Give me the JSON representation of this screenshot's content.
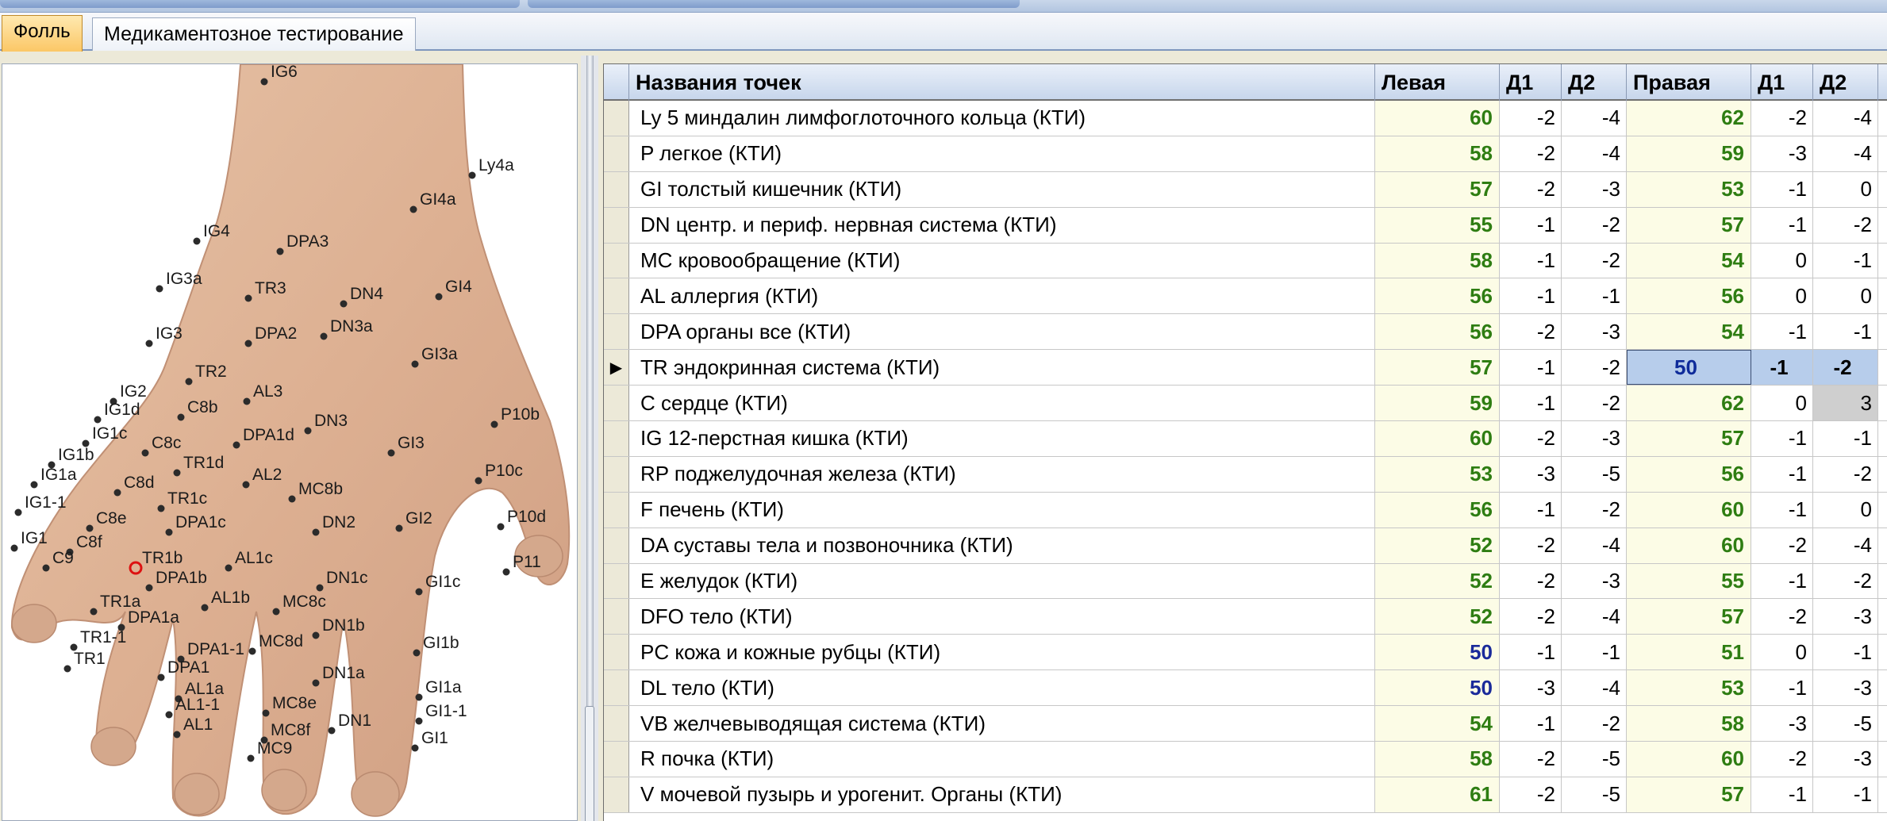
{
  "tabs": [
    {
      "label": "Фолль",
      "active": true
    },
    {
      "label": "Медикаментозное тестирование",
      "active": false
    }
  ],
  "grid": {
    "columns": [
      "Названия точек",
      "Левая",
      "Д1",
      "Д2",
      "Правая",
      "Д1",
      "Д2"
    ],
    "selected_row": 7,
    "rows": [
      {
        "name": "Ly  5 миндалин лимфоглоточного кольца (КТИ)",
        "left": "60",
        "ld1": "-2",
        "ld2": "-4",
        "right": "62",
        "rd1": "-2",
        "rd2": "-4"
      },
      {
        "name": "P  легкое (КТИ)",
        "left": "58",
        "ld1": "-2",
        "ld2": "-4",
        "right": "59",
        "rd1": "-3",
        "rd2": "-4"
      },
      {
        "name": "GI  толстый кишечник (КТИ)",
        "left": "57",
        "ld1": "-2",
        "ld2": "-3",
        "right": "53",
        "rd1": "-1",
        "rd2": "0"
      },
      {
        "name": "DN  центр. и периф. нервная система (КТИ)",
        "left": "55",
        "ld1": "-1",
        "ld2": "-2",
        "right": "57",
        "rd1": "-1",
        "rd2": "-2"
      },
      {
        "name": "MC кровообращение (КТИ)",
        "left": "58",
        "ld1": "-1",
        "ld2": "-2",
        "right": "54",
        "rd1": "0",
        "rd2": "-1"
      },
      {
        "name": "AL аллергия (КТИ)",
        "left": "56",
        "ld1": "-1",
        "ld2": "-1",
        "right": "56",
        "rd1": "0",
        "rd2": "0"
      },
      {
        "name": "DPA органы все (КТИ)",
        "left": "56",
        "ld1": "-2",
        "ld2": "-3",
        "right": "54",
        "rd1": "-1",
        "rd2": "-1"
      },
      {
        "name": "TR эндокринная система (КТИ)",
        "left": "57",
        "ld1": "-1",
        "ld2": "-2",
        "right": "50",
        "rd1": "-1",
        "rd2": "-2"
      },
      {
        "name": "C сердце (КТИ)",
        "left": "59",
        "ld1": "-1",
        "ld2": "-2",
        "right": "62",
        "rd1": "0",
        "rd2": "3"
      },
      {
        "name": "IG 12-перстная кишка (КТИ)",
        "left": "60",
        "ld1": "-2",
        "ld2": "-3",
        "right": "57",
        "rd1": "-1",
        "rd2": "-1"
      },
      {
        "name": "RP поджелудочная железа (КТИ)",
        "left": "53",
        "ld1": "-3",
        "ld2": "-5",
        "right": "56",
        "rd1": "-1",
        "rd2": "-2"
      },
      {
        "name": "F печень (КТИ)",
        "left": "56",
        "ld1": "-1",
        "ld2": "-2",
        "right": "60",
        "rd1": "-1",
        "rd2": "0"
      },
      {
        "name": "DA суставы тела и позвоночника (КТИ)",
        "left": "52",
        "ld1": "-2",
        "ld2": "-4",
        "right": "60",
        "rd1": "-2",
        "rd2": "-4"
      },
      {
        "name": "E желудок (КТИ)",
        "left": "52",
        "ld1": "-2",
        "ld2": "-3",
        "right": "55",
        "rd1": "-1",
        "rd2": "-2"
      },
      {
        "name": "DFO тело (КТИ)",
        "left": "52",
        "ld1": "-2",
        "ld2": "-4",
        "right": "57",
        "rd1": "-2",
        "rd2": "-3"
      },
      {
        "name": "PC кожа и кожные рубцы (КТИ)",
        "left": "50",
        "ld1": "-1",
        "ld2": "-1",
        "right": "51",
        "rd1": "0",
        "rd2": "-1"
      },
      {
        "name": "DL тело (КТИ)",
        "left": "50",
        "ld1": "-3",
        "ld2": "-4",
        "right": "53",
        "rd1": "-1",
        "rd2": "-3"
      },
      {
        "name": "VB желчевыводящая система (КТИ)",
        "left": "54",
        "ld1": "-1",
        "ld2": "-2",
        "right": "58",
        "rd1": "-3",
        "rd2": "-5"
      },
      {
        "name": "R почка (КТИ)",
        "left": "58",
        "ld1": "-2",
        "ld2": "-5",
        "right": "60",
        "rd1": "-2",
        "rd2": "-3"
      },
      {
        "name": "V мочевой пузырь и урогенит. Органы (КТИ)",
        "left": "61",
        "ld1": "-2",
        "ld2": "-5",
        "right": "57",
        "rd1": "-1",
        "rd2": "-1"
      }
    ]
  },
  "hand_points": [
    "IG6",
    "Ly4a",
    "GI4a",
    "IG4",
    "DPA3",
    "IG3a",
    "TR3",
    "DN4",
    "GI4",
    "IG3",
    "DPA2",
    "DN3a",
    "GI3a",
    "TR2",
    "AL3",
    "IG2",
    "IG1d",
    "C8b",
    "DN3",
    "P10b",
    "IG1c",
    "DPA1d",
    "GI3",
    "C8c",
    "IG1b",
    "TR1d",
    "IG1a",
    "C8d",
    "AL2",
    "P10c",
    "MC8b",
    "TR1c",
    "IG1-1",
    "C8e",
    "DPA1c",
    "DN2",
    "GI2",
    "P10d",
    "IG1",
    "C8f",
    "C9",
    "TR1b",
    "AL1c",
    "P11",
    "DPA1b",
    "DN1c",
    "GI1c",
    "AL1b",
    "MC8c",
    "TR1a",
    "DPA1a",
    "DN1b",
    "TR1-1",
    "MC8d",
    "GI1b",
    "TR1",
    "DPA1-1",
    "DPA1",
    "DN1a",
    "AL1a",
    "GI1a",
    "AL1-1",
    "MC8e",
    "GI1-1",
    "DN1",
    "AL1",
    "MC8f",
    "GI1",
    "MC9"
  ],
  "colors": {
    "value_green": "#2e7d12",
    "value_blue": "#1a2a9a",
    "selection": "#b7cdeb",
    "tab_active": "#fbc766"
  }
}
